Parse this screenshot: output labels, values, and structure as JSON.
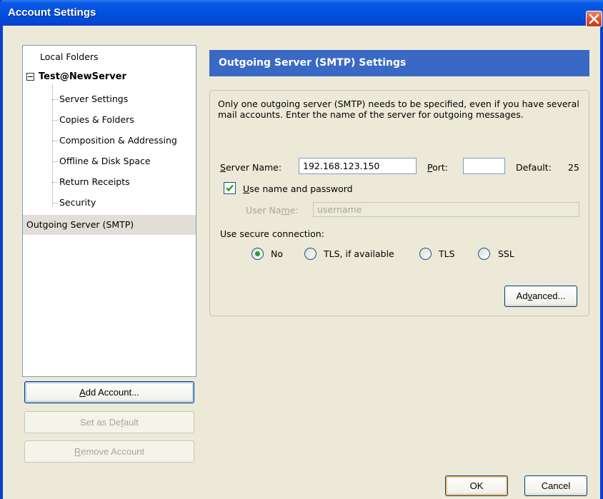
{
  "window": {
    "title": "Account Settings"
  },
  "tree": {
    "local_folders": "Local Folders",
    "account": "Test@NewServer",
    "children": [
      "Server Settings",
      "Copies & Folders",
      "Composition & Addressing",
      "Offline & Disk Space",
      "Return Receipts",
      "Security"
    ],
    "outgoing": "Outgoing Server (SMTP)",
    "selected": "Outgoing Server (SMTP)"
  },
  "left_buttons": {
    "add_account": {
      "pre": "",
      "key": "A",
      "post": "dd Account..."
    },
    "set_default": {
      "pre": "Set as De",
      "key": "f",
      "post": "ault"
    },
    "remove_account": {
      "pre": "",
      "key": "R",
      "post": "emove Account"
    }
  },
  "panel": {
    "header": "Outgoing Server (SMTP) Settings",
    "description": "Only one outgoing server (SMTP) needs to be specified, even if you have several mail accounts. Enter the name of the server for outgoing messages.",
    "server_name_label": {
      "key": "S",
      "rest": "erver Name:"
    },
    "server_name_value": "192.168.123.150",
    "port_label": {
      "key": "P",
      "rest": "ort:"
    },
    "port_value": "",
    "default_label": "Default:",
    "default_value": "25",
    "use_name_password": {
      "pre": "",
      "key": "U",
      "post": "se name and password",
      "checked": true
    },
    "user_name_label": {
      "pre": "User Na",
      "key": "m",
      "post": "e:"
    },
    "user_name_placeholder": "username",
    "secure_label": "Use secure connection:",
    "secure_options": [
      {
        "label": "No",
        "selected": true
      },
      {
        "label": "TLS, if available",
        "selected": false
      },
      {
        "label": "TLS",
        "selected": false
      },
      {
        "label": "SSL",
        "selected": false
      }
    ],
    "advanced": {
      "pre": "Ad",
      "key": "v",
      "post": "anced..."
    }
  },
  "footer": {
    "ok": "OK",
    "cancel": "Cancel"
  },
  "colors": {
    "titlebar": "#0451df",
    "header_bar": "#3a69c5",
    "dialog_bg": "#ece9d8",
    "radio_dot": "#2d9a3a"
  }
}
